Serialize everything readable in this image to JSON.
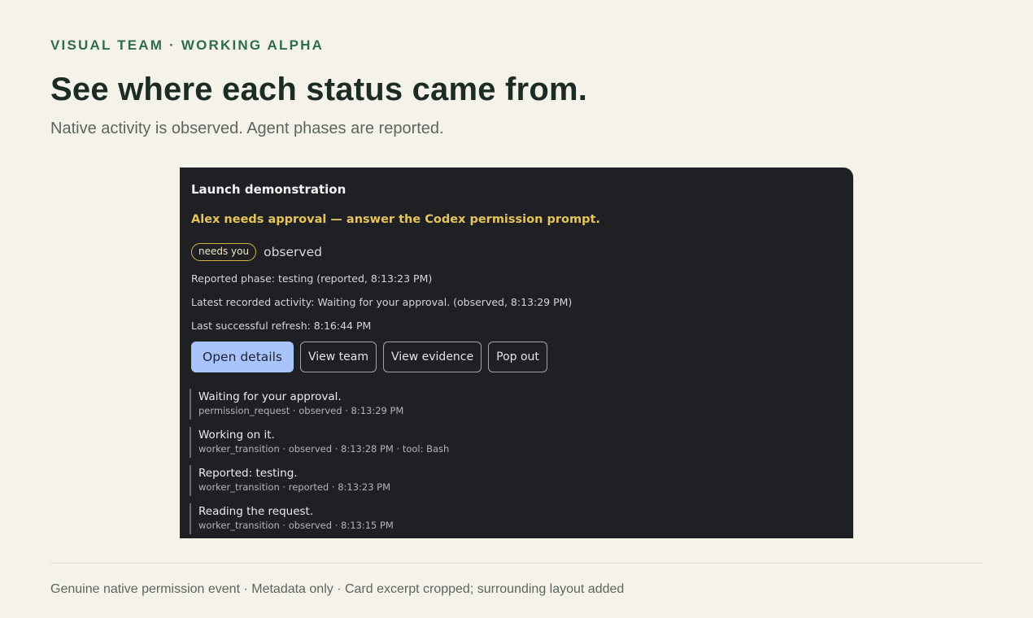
{
  "header": {
    "eyebrow": "VISUAL TEAM · WORKING ALPHA",
    "headline": "See where each status came from.",
    "subhead": "Native activity is observed. Agent phases are reported."
  },
  "card": {
    "title": "Launch demonstration",
    "alert": "Alex needs approval — answer the Codex permission prompt.",
    "badge": "needs you",
    "status": "observed",
    "meta": [
      "Reported phase: testing (reported, 8:13:23 PM)",
      "Latest recorded activity: Waiting for your approval. (observed, 8:13:29 PM)",
      "Last successful refresh: 8:16:44 PM"
    ],
    "buttons": {
      "open_details": "Open details",
      "view_team": "View team",
      "view_evidence": "View evidence",
      "pop_out": "Pop out"
    },
    "events": [
      {
        "title": "Waiting for your approval.",
        "meta": "permission_request · observed · 8:13:29 PM"
      },
      {
        "title": "Working on it.",
        "meta": "worker_transition · observed · 8:13:28 PM · tool: Bash"
      },
      {
        "title": "Reported: testing.",
        "meta": "worker_transition · reported · 8:13:23 PM"
      },
      {
        "title": "Reading the request.",
        "meta": "worker_transition · observed · 8:13:15 PM"
      }
    ]
  },
  "footer": {
    "note": "Genuine native permission event · Metadata only · Card excerpt cropped; surrounding layout added"
  },
  "colors": {
    "page_background": "#f4f2e9",
    "accent_green": "#2f6b4c",
    "card_background": "#1f2024",
    "alert_yellow": "#e6c45c",
    "primary_button": "#a9c4fb"
  }
}
